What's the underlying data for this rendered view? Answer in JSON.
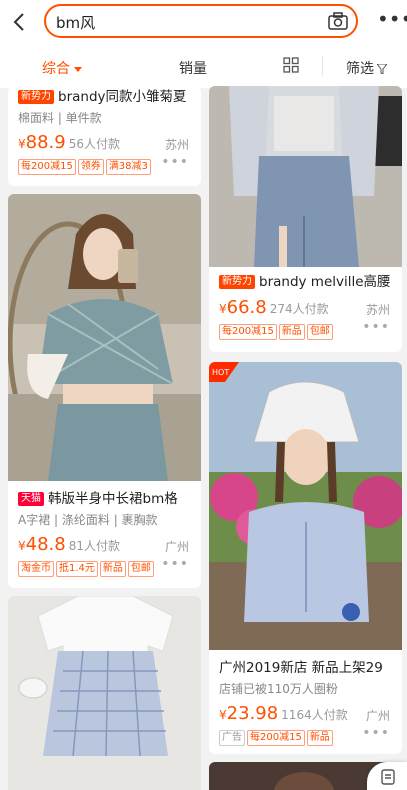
{
  "search": {
    "query": "bm风"
  },
  "sortbar": {
    "comprehensive": "综合",
    "sales": "销量",
    "filter": "筛选"
  },
  "colors": {
    "accent": "#ff5000",
    "tmall": "#ff0036"
  },
  "left": [
    {
      "tag": "新势力",
      "title": "brandy同款小雏菊夏",
      "sub": "棉面料 | 单件款",
      "yen": "¥",
      "price": "88.9",
      "sold": "56人付款",
      "loc": "苏州",
      "badges": [
        "每200减15",
        "领券",
        "满38减3"
      ]
    },
    {
      "tag": "天猫",
      "title": "韩版半身中长裙bm格",
      "sub": "A字裙 | 涤纶面料 | 裹胸款",
      "yen": "¥",
      "price": "48.8",
      "sold": "81人付款",
      "loc": "广州",
      "badges": [
        "淘金币",
        "抵1.4元",
        "新品",
        "包邮"
      ]
    }
  ],
  "right": [
    {
      "tag": "新势力",
      "title": "brandy melville高腰",
      "yen": "¥",
      "price": "66.8",
      "sold": "274人付款",
      "loc": "苏州",
      "badges": [
        "每200减15",
        "新品",
        "包邮"
      ]
    },
    {
      "hot": "HOT",
      "title": "广州2019新店 新品上架29",
      "sub": "店铺已被110万人圈粉",
      "yen": "¥",
      "price": "23.98",
      "sold": "1164人付款",
      "loc": "广州",
      "badges": [
        "广告",
        "每200减15",
        "新品"
      ]
    }
  ],
  "icons": [
    "back-arrow-icon",
    "camera-icon",
    "more-dots-icon",
    "grid-view-icon",
    "filter-icon"
  ]
}
